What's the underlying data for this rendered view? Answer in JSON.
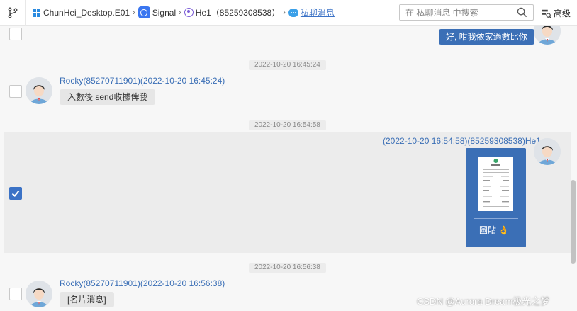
{
  "breadcrumb": {
    "device": "ChunHei_Desktop.E01",
    "app": "Signal",
    "contact": "He1（85259308538）",
    "category": "私聊消息"
  },
  "search": {
    "placeholder": "在 私聊消息 中搜索"
  },
  "advanced_label": "高级",
  "messages": {
    "m0": {
      "text": "好, 咁我依家過數比你"
    },
    "ts1": "2022-10-20 16:45:24",
    "m1": {
      "sender": "Rocky(85270711901)(2022-10-20 16:45:24)",
      "text": "入數後 send收據俾我"
    },
    "ts2": "2022-10-20 16:54:58",
    "m2": {
      "sender": "(2022-10-20 16:54:58)(85259308538)He1",
      "caption": "圖貼 👌",
      "selected": true
    },
    "ts3": "2022-10-20 16:56:38",
    "m3": {
      "sender": "Rocky(85270711901)(2022-10-20 16:56:38)",
      "text": "[名片消息]"
    }
  },
  "watermark": "CSDN @Aurora Dream极光之梦",
  "colors": {
    "accent": "#3b6fb6",
    "selected_row": "#ececec"
  }
}
